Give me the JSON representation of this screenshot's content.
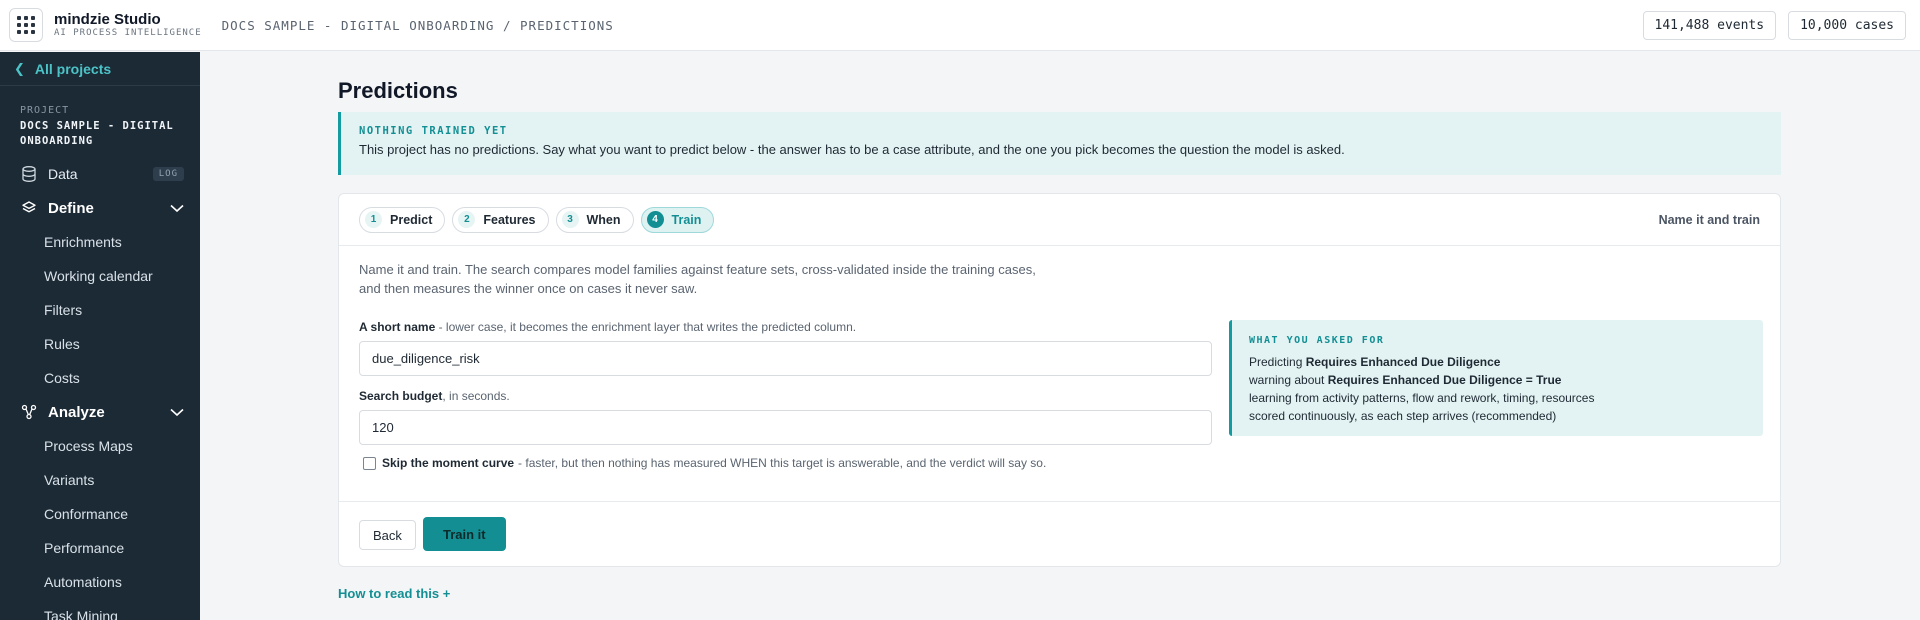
{
  "header": {
    "brand_name": "mindzie Studio",
    "brand_sub": "AI PROCESS INTELLIGENCE",
    "breadcrumb": "DOCS SAMPLE - DIGITAL ONBOARDING / PREDICTIONS",
    "events": "141,488 events",
    "cases": "10,000 cases"
  },
  "sidebar": {
    "back_label": "All projects",
    "project_label": "PROJECT",
    "project_name": "DOCS SAMPLE - DIGITAL ONBOARDING",
    "data_label": "Data",
    "data_badge": "LOG",
    "define_label": "Define",
    "define_items": [
      "Enrichments",
      "Working calendar",
      "Filters",
      "Rules",
      "Costs"
    ],
    "analyze_label": "Analyze",
    "analyze_items": [
      "Process Maps",
      "Variants",
      "Conformance",
      "Performance",
      "Automations",
      "Task Mining"
    ]
  },
  "main": {
    "title": "Predictions",
    "notice_head": "NOTHING TRAINED YET",
    "notice_body": "This project has no predictions. Say what you want to predict below - the answer has to be a case attribute, and the one you pick becomes the question the model is asked.",
    "steps": [
      {
        "num": "1",
        "label": "Predict"
      },
      {
        "num": "2",
        "label": "Features"
      },
      {
        "num": "3",
        "label": "When"
      },
      {
        "num": "4",
        "label": "Train"
      }
    ],
    "steps_right": "Name it and train",
    "intro": "Name it and train. The search compares model families against feature sets, cross-validated inside the training cases, and then measures the winner once on cases it never saw.",
    "name_label_bold": "A short name",
    "name_label_rest": " - lower case, it becomes the enrichment layer that writes the predicted column.",
    "name_value": "due_diligence_risk",
    "budget_label_bold": "Search budget",
    "budget_label_rest": ", in seconds.",
    "budget_value": "120",
    "skip_bold": "Skip the moment curve",
    "skip_rest": "- faster, but then nothing has measured WHEN this target is answerable, and the verdict will say so.",
    "asked_head": "WHAT YOU ASKED FOR",
    "asked_l1_pre": "Predicting ",
    "asked_l1_bold": "Requires Enhanced Due Diligence",
    "asked_l2_pre": "warning about ",
    "asked_l2_bold": "Requires Enhanced Due Diligence = True",
    "asked_l3": "learning from activity patterns, flow and rework, timing, resources",
    "asked_l4": "scored continuously, as each step arrives (recommended)",
    "back_button": "Back",
    "train_button": "Train it",
    "howto": "How to read this +"
  },
  "colors": {
    "accent": "#138f94",
    "sidebar_bg": "#1c2a36",
    "notice_bg": "#e3f3f3"
  }
}
